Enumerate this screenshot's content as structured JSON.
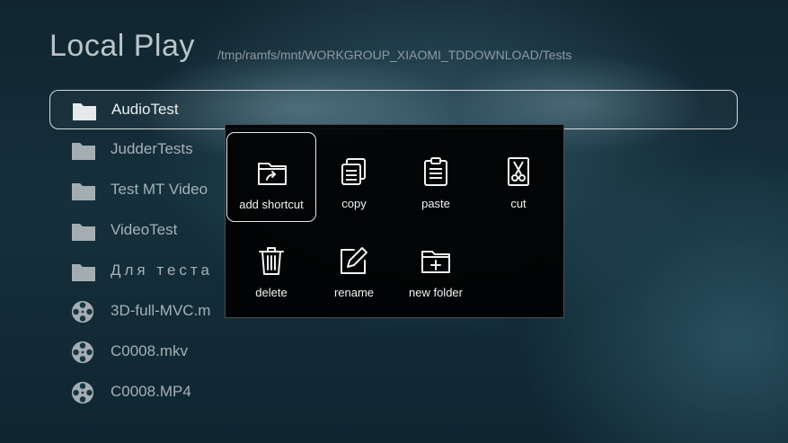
{
  "header": {
    "title": "Local Play",
    "path": "/tmp/ramfs/mnt/WORKGROUP_XIAOMI_TDDOWNLOAD/Tests"
  },
  "files": [
    {
      "label": "AudioTest",
      "icon": "folder-icon",
      "selected": true
    },
    {
      "label": "JudderTests",
      "icon": "folder-icon",
      "selected": false
    },
    {
      "label": "Test MT Video",
      "icon": "folder-icon",
      "selected": false
    },
    {
      "label": "VideoTest",
      "icon": "folder-icon",
      "selected": false
    },
    {
      "label": "Для теста",
      "icon": "folder-icon",
      "selected": false
    },
    {
      "label": "3D-full-MVC.m",
      "icon": "film-reel-icon",
      "selected": false
    },
    {
      "label": "C0008.mkv",
      "icon": "film-reel-icon",
      "selected": false
    },
    {
      "label": "C0008.MP4",
      "icon": "film-reel-icon",
      "selected": false
    }
  ],
  "context_menu": {
    "items": [
      {
        "label": "add shortcut",
        "icon": "folder-shortcut-icon",
        "focused": true
      },
      {
        "label": "copy",
        "icon": "copy-icon",
        "focused": false
      },
      {
        "label": "paste",
        "icon": "clipboard-icon",
        "focused": false
      },
      {
        "label": "cut",
        "icon": "scissors-icon",
        "focused": false
      },
      {
        "label": "delete",
        "icon": "trash-icon",
        "focused": false
      },
      {
        "label": "rename",
        "icon": "edit-icon",
        "focused": false
      },
      {
        "label": "new folder",
        "icon": "new-folder-icon",
        "focused": false
      }
    ]
  },
  "colors": {
    "background": "#15303c",
    "menu_background": "#000000",
    "selection_border": "#ebf0f2"
  }
}
